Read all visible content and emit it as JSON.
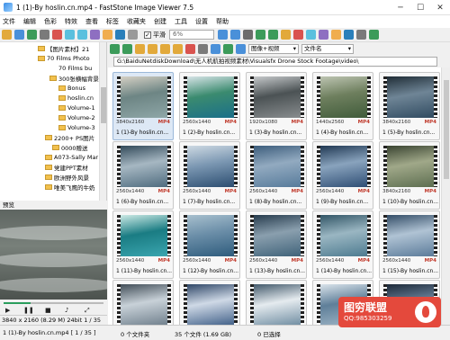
{
  "window": {
    "title": "1 (1)-By hoslin.cn.mp4 - FastStone Image Viewer 7.5",
    "minimize": "─",
    "maximize": "☐",
    "close": "✕"
  },
  "menu": [
    "文件",
    "编辑",
    "色彩",
    "特效",
    "查看",
    "标签",
    "收藏夹",
    "创建",
    "工具",
    "设置",
    "帮助"
  ],
  "toolbar": {
    "smooth_label": "平滑",
    "smooth_checked": true,
    "zoom_value": "6%"
  },
  "browser": {
    "filter_value": "图像+视频",
    "sort_value": "文件名"
  },
  "folder_tree": [
    "【图片素材】21",
    "70 Films Photo",
    "70 Films bu",
    "300张横幅背景",
    "Bonus",
    "hoslin.cn",
    "Volume-1",
    "Volume-2",
    "Volume-3",
    "2200+ PS图片",
    "0000赠送",
    "A073-Sally Mar",
    "党建PPT素材",
    "欧洲野外风景",
    "唯美飞鹰的牛奶"
  ],
  "preview": {
    "label": "预览",
    "info": "3840 x 2160 (8.29 M)  24bit  1 / 35"
  },
  "path": "G:\\BaiduNetdiskDownload\\无人机航拍视频素材\\Visualsfx Drone Stock Footage\\video\\",
  "thumbnails": [
    {
      "name": "1 (1)-By hoslin.cn...",
      "res": "3840x2160",
      "fmt": "MP4"
    },
    {
      "name": "1 (2)-By hoslin.cn...",
      "res": "2560x1440",
      "fmt": "MP4"
    },
    {
      "name": "1 (3)-By hoslin.cn...",
      "res": "1920x1080",
      "fmt": "MP4"
    },
    {
      "name": "1 (4)-By hoslin.cn...",
      "res": "1440x2560",
      "fmt": "MP4"
    },
    {
      "name": "1 (5)-By hoslin.cn...",
      "res": "3840x2160",
      "fmt": "MP4"
    },
    {
      "name": "1 (6)-By hoslin.cn...",
      "res": "2560x1440",
      "fmt": "MP4"
    },
    {
      "name": "1 (7)-By hoslin.cn...",
      "res": "2560x1440",
      "fmt": "MP4"
    },
    {
      "name": "1 (8)-By hoslin.cn...",
      "res": "2560x1440",
      "fmt": "MP4"
    },
    {
      "name": "1 (9)-By hoslin.cn...",
      "res": "2560x1440",
      "fmt": "MP4"
    },
    {
      "name": "1 (10)-By hoslin.cn...",
      "res": "3840x2160",
      "fmt": "MP4"
    },
    {
      "name": "1 (11)-By hoslin.cn...",
      "res": "2560x1440",
      "fmt": "MP4"
    },
    {
      "name": "1 (12)-By hoslin.cn...",
      "res": "2560x1440",
      "fmt": "MP4"
    },
    {
      "name": "1 (13)-By hoslin.cn...",
      "res": "2560x1440",
      "fmt": "MP4"
    },
    {
      "name": "1 (14)-By hoslin.cn...",
      "res": "2560x1440",
      "fmt": "MP4"
    },
    {
      "name": "1 (15)-By hoslin.cn...",
      "res": "2560x1440",
      "fmt": "MP4"
    },
    {
      "name": "",
      "res": "",
      "fmt": ""
    },
    {
      "name": "",
      "res": "",
      "fmt": ""
    },
    {
      "name": "",
      "res": "",
      "fmt": ""
    },
    {
      "name": "",
      "res": "",
      "fmt": ""
    },
    {
      "name": "",
      "res": "",
      "fmt": ""
    }
  ],
  "status": {
    "file": "1 (1)-By hoslin.cn.mp4 [ 1 / 35 ]",
    "folders": "0 个文件夹",
    "files": "35 个文件 (1.69 GB)",
    "selected": "0 已选择"
  },
  "watermark": {
    "title": "图穷联盟",
    "qq": "QQ:985303259"
  }
}
